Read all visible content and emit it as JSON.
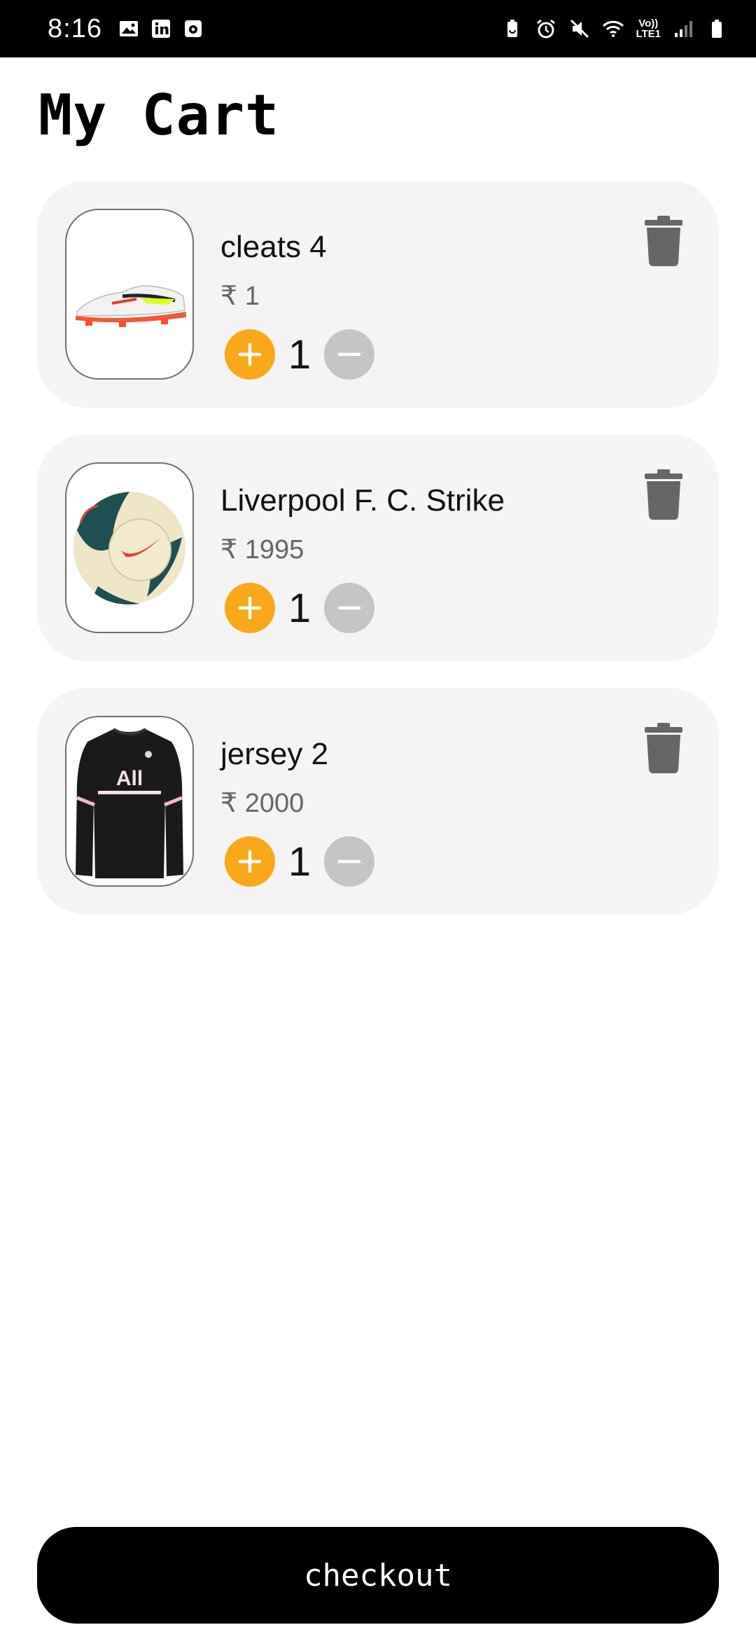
{
  "status_bar": {
    "time": "8:16",
    "network_label_top": "Vo))",
    "network_label_bottom": "LTE1"
  },
  "page": {
    "title": "My Cart"
  },
  "currency_symbol": "₹",
  "items": [
    {
      "name": "cleats 4",
      "price": "₹ 1",
      "quantity": "1",
      "image": "cleats-image"
    },
    {
      "name": "Liverpool F. C. Strike",
      "price": "₹ 1995",
      "quantity": "1",
      "image": "football-image"
    },
    {
      "name": "jersey 2",
      "price": "₹ 2000",
      "quantity": "1",
      "image": "jersey-image"
    }
  ],
  "checkout": {
    "label": "checkout"
  },
  "colors": {
    "accent": "#f9a81a",
    "card_bg": "#f4f4f4",
    "minus_bg": "#c4c4c4",
    "trash": "#666666",
    "checkout_bg": "#000000"
  }
}
